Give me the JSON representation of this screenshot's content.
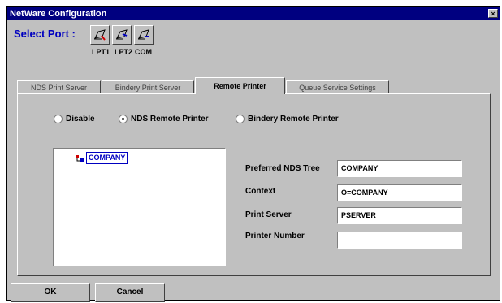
{
  "window": {
    "title": "NetWare Configuration",
    "close_label": "×"
  },
  "port": {
    "label": "Select Port :",
    "options": [
      {
        "label": "LPT1",
        "icon": "printer-port-1-icon"
      },
      {
        "label": "LPT2",
        "icon": "printer-port-2-icon"
      },
      {
        "label": "COM",
        "icon": "serial-port-icon"
      }
    ],
    "selected": "LPT1"
  },
  "tabs": [
    {
      "label": "NDS Print Server"
    },
    {
      "label": "Bindery Print Server"
    },
    {
      "label": "Remote Printer",
      "active": true
    },
    {
      "label": "Queue Service Settings"
    }
  ],
  "mode": {
    "options": [
      "Disable",
      "NDS Remote Printer",
      "Bindery Remote Printer"
    ],
    "selected": "NDS Remote Printer"
  },
  "tree": {
    "root_label": "COMPANY",
    "icon": "organization-icon"
  },
  "form": {
    "preferred_nds_tree": {
      "label": "Preferred NDS Tree",
      "value": "COMPANY"
    },
    "context": {
      "label": "Context",
      "value": "O=COMPANY"
    },
    "print_server": {
      "label": "Print Server",
      "value": "PSERVER"
    },
    "printer_number": {
      "label": "Printer Number",
      "value": ""
    }
  },
  "buttons": {
    "ok": "OK",
    "cancel": "Cancel"
  },
  "colors": {
    "titlebar": "#000080",
    "face": "#c0c0c0",
    "accent": "#0000c0",
    "highlight": "#d00000"
  }
}
